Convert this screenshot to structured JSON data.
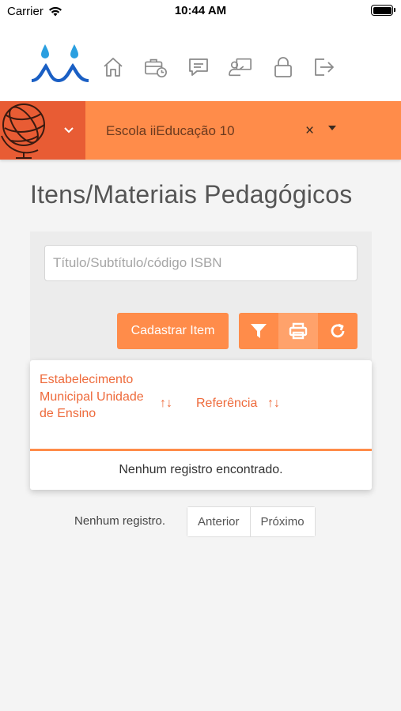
{
  "status_bar": {
    "carrier": "Carrier",
    "time": "10:44 AM"
  },
  "nav": {
    "icons": [
      "home-icon",
      "briefcase-clock-icon",
      "message-icon",
      "teacher-board-icon",
      "lock-icon",
      "logout-icon"
    ]
  },
  "school_bar": {
    "selected_school": "Escola iiEducação 10",
    "clear_symbol": "×"
  },
  "page": {
    "title": "Itens/Materiais Pedagógicos"
  },
  "search": {
    "placeholder": "Título/Subtítulo/código ISBN",
    "value": ""
  },
  "actions": {
    "register_label": "Cadastrar Item",
    "icon_buttons": [
      "filter-icon",
      "print-icon",
      "refresh-icon"
    ]
  },
  "table": {
    "columns": [
      {
        "label": "Estabelecimento Municipal Unidade de Ensino",
        "sort_symbol": "↑↓"
      },
      {
        "label": "Referência",
        "sort_symbol": "↑↓"
      }
    ],
    "empty_message": "Nenhum registro encontrado."
  },
  "pagination": {
    "info": "Nenhum registro.",
    "prev_label": "Anterior",
    "next_label": "Próximo"
  },
  "colors": {
    "accent": "#ff8c4a",
    "accent_dark": "#e85c34",
    "header_text": "#ee6a3b"
  }
}
